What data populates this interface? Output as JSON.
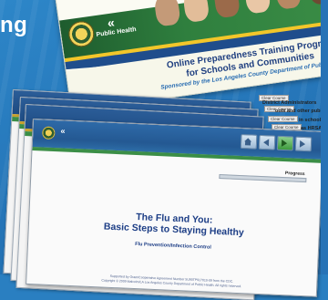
{
  "corner": {
    "word": "ng"
  },
  "banner": {
    "logo_text": "Public Health",
    "title_line1": "Online Preparedness Training Program",
    "title_line2": "for Schools and Communities",
    "sponsor": "Sponsored by the Los Angeles County Department of Public Health (LACDPH)"
  },
  "stack": {
    "clear_label": "Clear Course",
    "back_texts": [
      "District Administrators",
      "ools and other public",
      "in schools",
      "as HRSA"
    ]
  },
  "slide": {
    "progress_label": "Progress",
    "progress_fraction": 0.0,
    "title_line1": "The Flu and You:",
    "title_line2": "Basic Steps to Staying Healthy",
    "subtitle": "Flu Prevention/Infection Control",
    "fine_line1": "Supported by Grant/Cooperative Agreement Number 5U90TP917010-09 from the CDC.",
    "fine_line2": "Copyright © 2009 Malcolm/LA Los Angeles County Department of Public Health. All rights reserved."
  },
  "colors": {
    "brand_blue": "#1f3f80",
    "bar_blue": "#1f5088",
    "accent_green": "#3b8e47",
    "accent_gold": "#c9a12c"
  },
  "icons": [
    "home-icon",
    "back-arrow-icon",
    "play-icon",
    "forward-arrow-icon"
  ]
}
